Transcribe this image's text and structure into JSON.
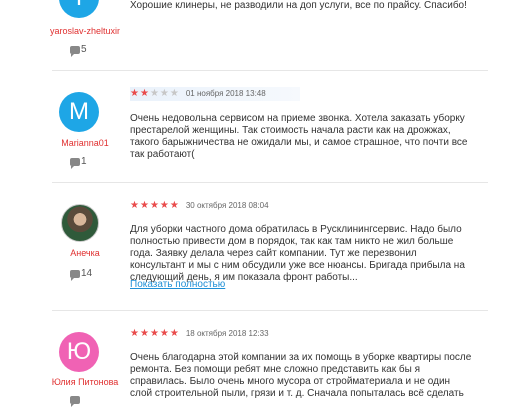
{
  "reviews": [
    {
      "username": "yaroslav-zheltuxin",
      "avatar_letter": "Y",
      "avatar_color": "#1ea6e6",
      "comments": "5",
      "text": "Хорошие клинеры, не разводили на доп услуги, все по прайсу. Спасибо!"
    },
    {
      "username": "Marianna01",
      "avatar_letter": "M",
      "avatar_color": "#1ea6e6",
      "rating": 2,
      "date": "01 ноября 2018 13:48",
      "comments": "1",
      "text_lines": [
        "Очень недовольна сервисом на приеме звонка. Хотела заказать уборку",
        "престарелой женщины. Так стоимость начала расти как на дрожжах,",
        "такого барыжничества не ожидали мы, и самое страшное, что почти все",
        "так работают("
      ]
    },
    {
      "username": "Анечка",
      "avatar_color": "#4a6a3a",
      "rating": 5,
      "date": "30 октября 2018 08:04",
      "comments": "14",
      "text_lines": [
        "Для уборки частного дома обратилась в Русклинингсервис. Надо было",
        "полностью привести дом в порядок, так как там никто не жил больше",
        "года. Заявку делала через сайт компании. Тут же перезвонил",
        "консультант и мы с ним обсудили уже все нюансы. Бригада прибыла на",
        "следующий день, я им показала фронт работы..."
      ],
      "more_link": "Показать полностью"
    },
    {
      "username": "Юлия Питонова",
      "avatar_letter": "Ю",
      "avatar_color": "#f062b4",
      "rating": 5,
      "date": "18 октября 2018 12:33",
      "text_lines": [
        "Очень благодарна этой компании за их помощь в уборке квартиры после",
        "ремонта. Без помощи ребят мне сложно представить как бы я",
        "справилась. Было очень много мусора от стройматериала и не один",
        "слой строительной пыли, грязи и т. д. Сначала попыталась всё сделать"
      ]
    }
  ]
}
